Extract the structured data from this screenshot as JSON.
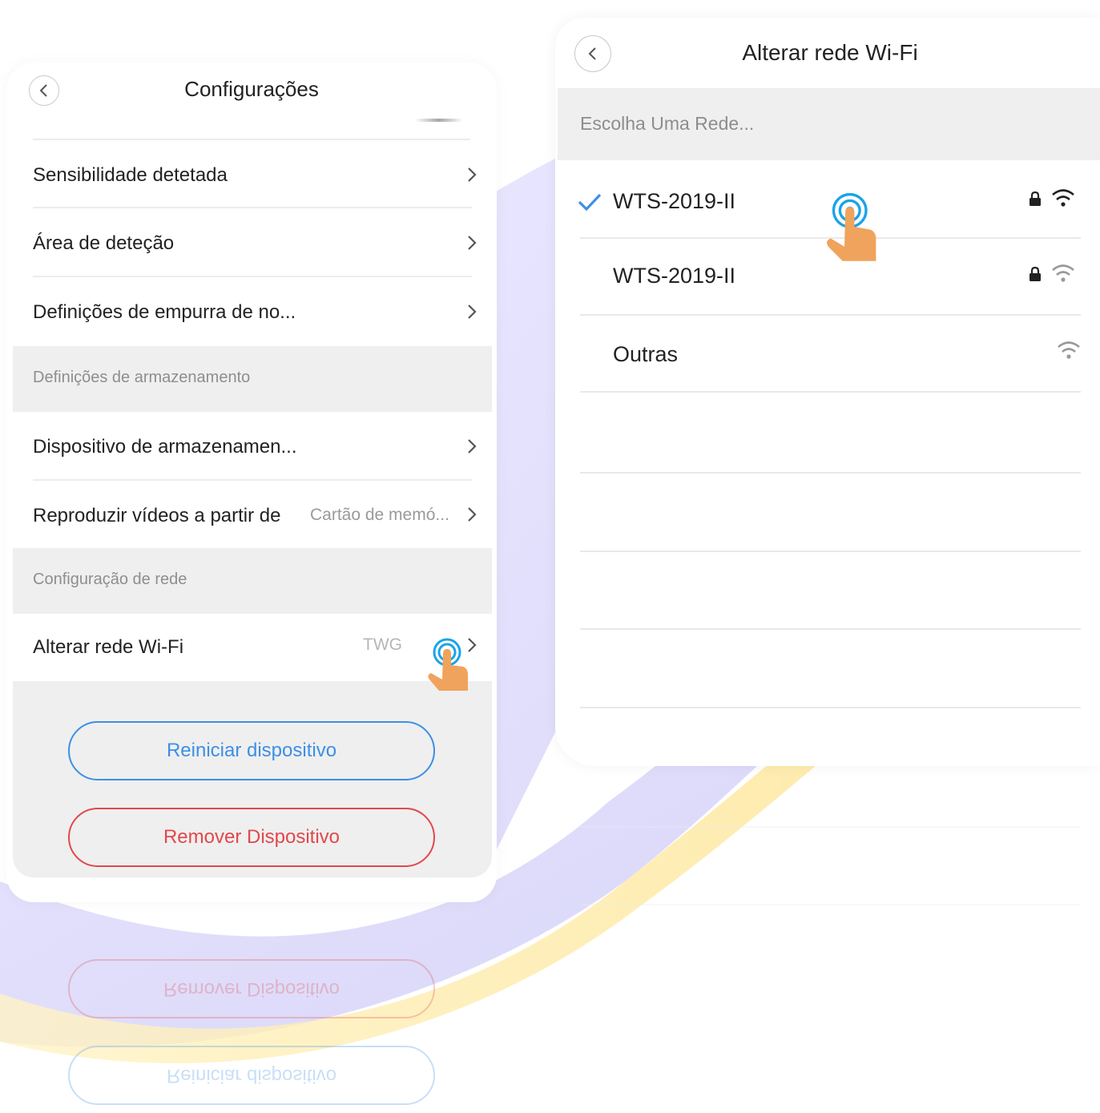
{
  "settings_screen": {
    "title": "Configurações",
    "rows": [
      {
        "label": "Sensibilidade detetada"
      },
      {
        "label": "Área de deteção"
      },
      {
        "label": "Definições de empurra de no..."
      }
    ],
    "storage_section": "Definições de armazenamento",
    "storage_rows": [
      {
        "label": "Dispositivo de armazenamen..."
      },
      {
        "label": "Reproduzir vídeos a partir de",
        "value": "Cartão de memó..."
      }
    ],
    "network_section": "Configuração de rede",
    "wifi_row": {
      "label": "Alterar rede Wi-Fi",
      "value": "TWG"
    },
    "restart_button": "Reiniciar dispositivo",
    "remove_button": "Remover Dispositivo"
  },
  "wifi_screen": {
    "title": "Alterar rede Wi-Fi",
    "search_placeholder": "Escolha Uma Rede...",
    "networks": [
      {
        "name": "WTS-2019-II",
        "selected": true,
        "locked": true,
        "icon": "wifi-icon"
      },
      {
        "name": "WTS-2019-II",
        "selected": false,
        "locked": true,
        "icon": "wifi-icon"
      },
      {
        "name": "Outras",
        "selected": false,
        "locked": false,
        "icon": "wifi-icon"
      }
    ]
  },
  "colors": {
    "accent_blue": "#3d8fe6",
    "danger_red": "#e2484b",
    "section_gray": "#efefef",
    "tap_orange": "#f0a35c",
    "tap_cyan": "#1aa3e8"
  }
}
